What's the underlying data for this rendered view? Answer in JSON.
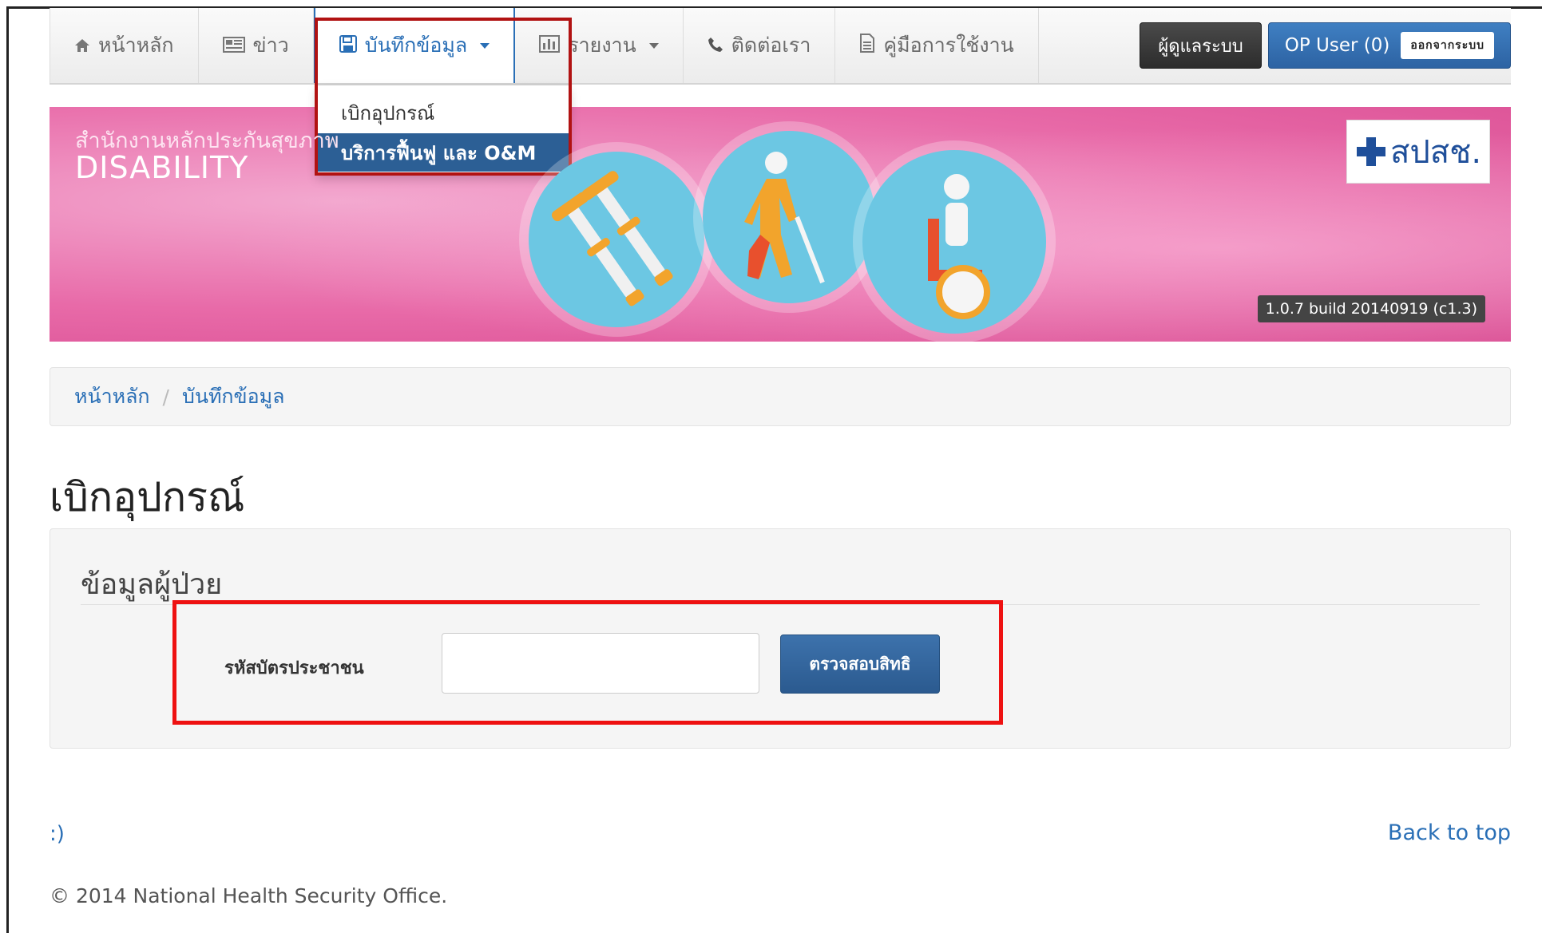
{
  "nav": {
    "items": [
      {
        "icon": "home-icon",
        "label": "หน้าหลัก"
      },
      {
        "icon": "newspaper-icon",
        "label": "ข่าว"
      },
      {
        "icon": "save-icon",
        "label": "บันทึกข้อมูล"
      },
      {
        "icon": "bar-chart-icon",
        "label": "รายงาน"
      },
      {
        "icon": "phone-icon",
        "label": "ติดต่อเรา"
      },
      {
        "icon": "document-icon",
        "label": "คู่มือการใช้งาน"
      }
    ],
    "admin_label": "ผู้ดูแลระบบ",
    "user_label": "OP User (0)",
    "logout_label": "ออกจากระบบ"
  },
  "dropdown": {
    "items": [
      {
        "label": "เบิกอุปกรณ์"
      },
      {
        "label": "บริการฟื้นฟู และ O&M"
      }
    ]
  },
  "banner": {
    "subtitle": "สำนักงานหลักประกันสุขภาพ",
    "title": "DISABILITY",
    "logo_text": "สปสช.",
    "version": "1.0.7 build 20140919 (c1.3)"
  },
  "breadcrumb": {
    "home": "หน้าหลัก",
    "separator": "/",
    "current": "บันทึกข้อมูล"
  },
  "page": {
    "title": "เบิกอุปกรณ์"
  },
  "panel": {
    "title": "ข้อมูลผู้ป่วย",
    "field_label": "รหัสบัตรประชาชน",
    "field_value": "",
    "check_button": "ตรวจสอบสิทธิ"
  },
  "footer": {
    "smile": ":)",
    "back_to_top": "Back to top",
    "copyright": "© 2014 National Health Security Office."
  },
  "colors": {
    "link": "#2a6fb6",
    "primary_button": "#2b5a8f",
    "banner_pink": "#e86aa8",
    "highlight_red": "#ee1111"
  }
}
